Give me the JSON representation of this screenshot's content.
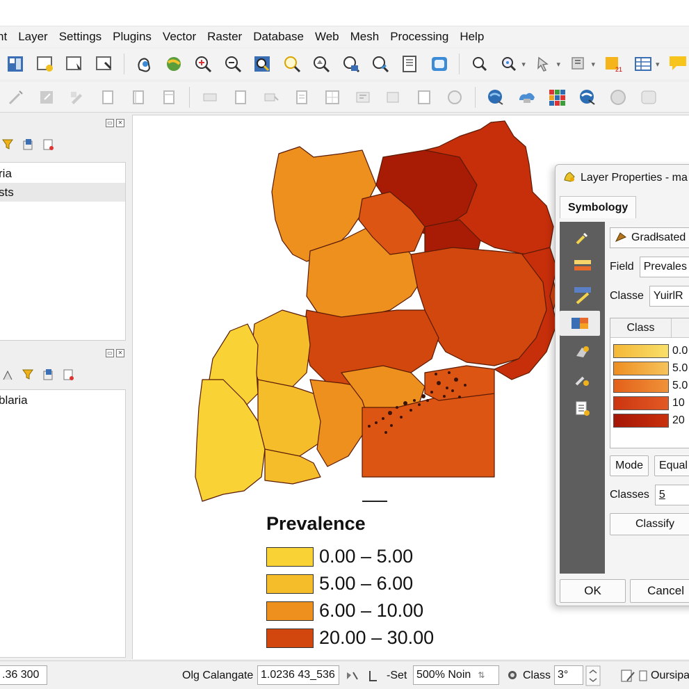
{
  "menu": {
    "items": [
      "nt",
      "Layer",
      "Settings",
      "Plugins",
      "Vector",
      "Raster",
      "Database",
      "Web",
      "Mesh",
      "Processing",
      "Help"
    ]
  },
  "toolbar1": {
    "icons": [
      "layout-icon",
      "new-layout-icon",
      "layout-manager-icon",
      "print-icon",
      "pan-icon",
      "pan-to-selection-icon",
      "zoom-in-icon",
      "zoom-out-icon",
      "zoom-full-icon",
      "zoom-selection-icon",
      "zoom-layer-icon",
      "zoom-native-icon",
      "zoom-last-icon",
      "zoom-next-icon",
      "new-bookmark-icon",
      "refresh-icon",
      "identify-icon",
      "select-features-icon",
      "select-value-icon",
      "deselect-icon",
      "attribute-table-icon",
      "statistics-icon",
      "annotation-icon"
    ]
  },
  "toolbar2": {
    "icons": [
      "digitize-icon",
      "edit-icon",
      "save-edits-icon",
      "add-feature-icon",
      "vertex-tool-icon",
      "delete-icon",
      "cut-icon",
      "copy-icon",
      "paste-icon",
      "undo-icon",
      "redo-icon",
      "label-icon",
      "label-pin-icon",
      "label-move-icon",
      "label-rotate-icon",
      "label-change-icon",
      "diagram-icon",
      "plugin-globe-icon",
      "plugin-cloud-icon",
      "plugin-grid-icon",
      "plugin-network-icon",
      "plugin-python-icon",
      "plugin-misc-icon"
    ]
  },
  "browser_panel": {
    "items": [
      "ria",
      "sts"
    ]
  },
  "layers_panel": {
    "items": [
      "blaria"
    ]
  },
  "map": {
    "colors": {
      "class1": "#f9d335",
      "class2": "#f6bd2a",
      "class3": "#ee901e",
      "class4": "#dc5512",
      "class5": "#c72e0a",
      "class6": "#a81c06"
    }
  },
  "legend": {
    "title": "Prevalence",
    "rows": [
      {
        "label": "0.00 – 5.00",
        "color": "#f9d335"
      },
      {
        "label": "5.00 – 6.00",
        "color": "#f6bd2a"
      },
      {
        "label": "6.00 – 10.00",
        "color": "#ee901e"
      },
      {
        "label": "20.00 – 30.00",
        "color": "#d2470e"
      }
    ]
  },
  "dialog": {
    "title": "Layer Properties - ma",
    "tab": "Symbology",
    "renderer": "Gradłsated",
    "field_label": "Field",
    "field_value": "Prevales",
    "classe_label": "Classe",
    "classe_value": "YuirlR",
    "class_header": "Class",
    "classes": [
      {
        "label": "0.0",
        "color": "#f8d34a"
      },
      {
        "label": "5.0",
        "color": "#f19a2a"
      },
      {
        "label": "5.0",
        "color": "#e56a1c"
      },
      {
        "label": "10",
        "color": "#d43d10"
      },
      {
        "label": "20",
        "color": "#b51c08"
      }
    ],
    "mode_label": "Mode",
    "mode_value": "Equal",
    "classes_label": "Classes",
    "classes_value": "5",
    "classify_button": "Classify",
    "ok_button": "OK",
    "cancel_button": "Cancel"
  },
  "status": {
    "coord_left": ".36 300",
    "coordinate_label": "Olg Calangate",
    "coordinate_value": "1.0236 43_536",
    "set_label": "-Set",
    "scale_value": "500% Noin",
    "class_label": "Class",
    "class_value": "3°",
    "render_label": "Oursipa"
  }
}
